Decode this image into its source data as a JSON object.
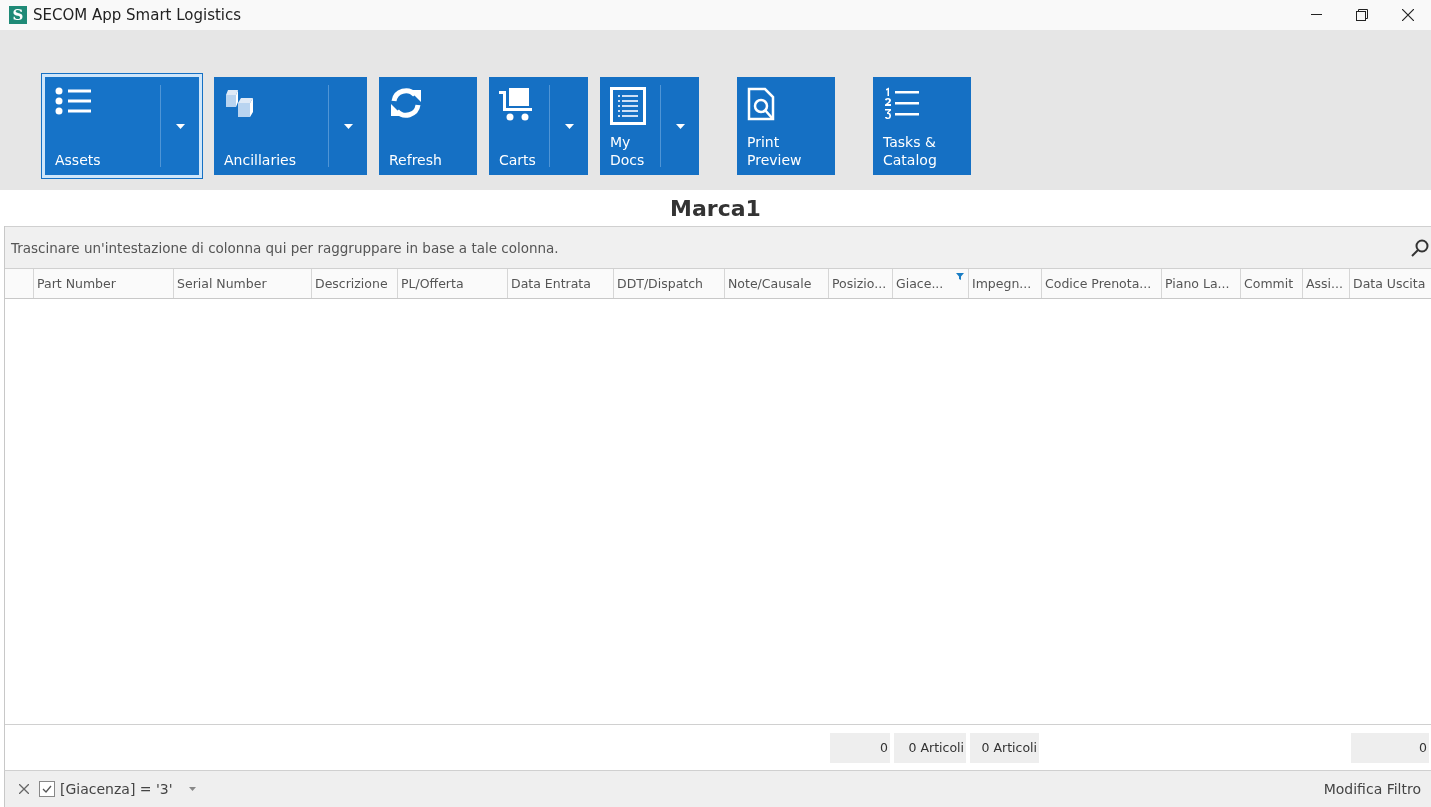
{
  "window": {
    "title": "SECOM App Smart Logistics",
    "logo": "S"
  },
  "toolbar": {
    "groups": [
      {
        "buttons": [
          {
            "label": "Assets",
            "kind": "list",
            "dropdown": true,
            "selected": true
          },
          {
            "label": "Ancillaries",
            "kind": "cubes",
            "dropdown": true,
            "selected": false
          },
          {
            "label": "Refresh",
            "kind": "refresh",
            "dropdown": false,
            "selected": false
          },
          {
            "label": "Carts",
            "kind": "cart",
            "dropdown": true,
            "selected": false
          },
          {
            "label": "My Docs",
            "kind": "doc",
            "dropdown": true,
            "selected": false
          }
        ]
      },
      {
        "buttons": [
          {
            "label": "Print Preview",
            "kind": "preview",
            "dropdown": false,
            "selected": false
          }
        ]
      },
      {
        "buttons": [
          {
            "label": "Tasks & Catalog",
            "kind": "numbered",
            "dropdown": false,
            "selected": false
          }
        ]
      }
    ]
  },
  "grid": {
    "title": "Marca1",
    "group_panel": "Trascinare un'intestazione di colonna qui per raggruppare in base a tale colonna.",
    "columns": [
      {
        "label": "Part Number",
        "filtered": false
      },
      {
        "label": "Serial Number",
        "filtered": false
      },
      {
        "label": "Descrizione",
        "filtered": false
      },
      {
        "label": "PL/Offerta",
        "filtered": false
      },
      {
        "label": "Data Entrata",
        "filtered": false
      },
      {
        "label": "DDT/Dispatch",
        "filtered": false
      },
      {
        "label": "Note/Causale",
        "filtered": false
      },
      {
        "label": "Posizio...",
        "filtered": false,
        "summary": "0"
      },
      {
        "label": "Giace...",
        "filtered": true,
        "summary": "0 Articoli"
      },
      {
        "label": "Impegn...",
        "filtered": false,
        "summary": "0 Articoli"
      },
      {
        "label": "Codice Prenota...",
        "filtered": false
      },
      {
        "label": "Piano La...",
        "filtered": false
      },
      {
        "label": "Commit",
        "filtered": false
      },
      {
        "label": "Assi...",
        "filtered": false
      },
      {
        "label": "Data Uscita",
        "filtered": false,
        "summary": "0"
      }
    ]
  },
  "filter_bar": {
    "expression": "[Giacenza] = '3'",
    "enabled": true,
    "edit_link": "Modifica Filtro"
  }
}
